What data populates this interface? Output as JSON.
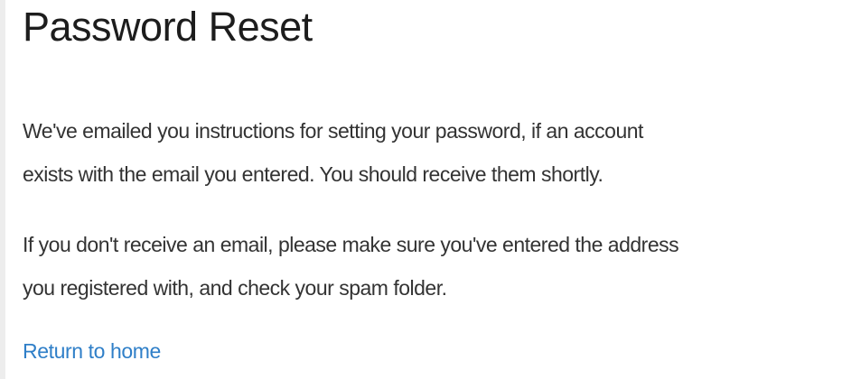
{
  "page": {
    "title": "Password Reset",
    "paragraphs": [
      {
        "lines": [
          "We've emailed you instructions for setting your password, if an account",
          "exists with the email you entered. You should receive them shortly."
        ]
      },
      {
        "lines": [
          "If you don't receive an email, please make sure you've entered the address",
          "you registered with, and check your spam folder."
        ]
      }
    ],
    "return_link": "Return to home"
  },
  "colors": {
    "link": "#2f7fc8",
    "title": "#1d1d1d",
    "body_text": "#333333"
  }
}
